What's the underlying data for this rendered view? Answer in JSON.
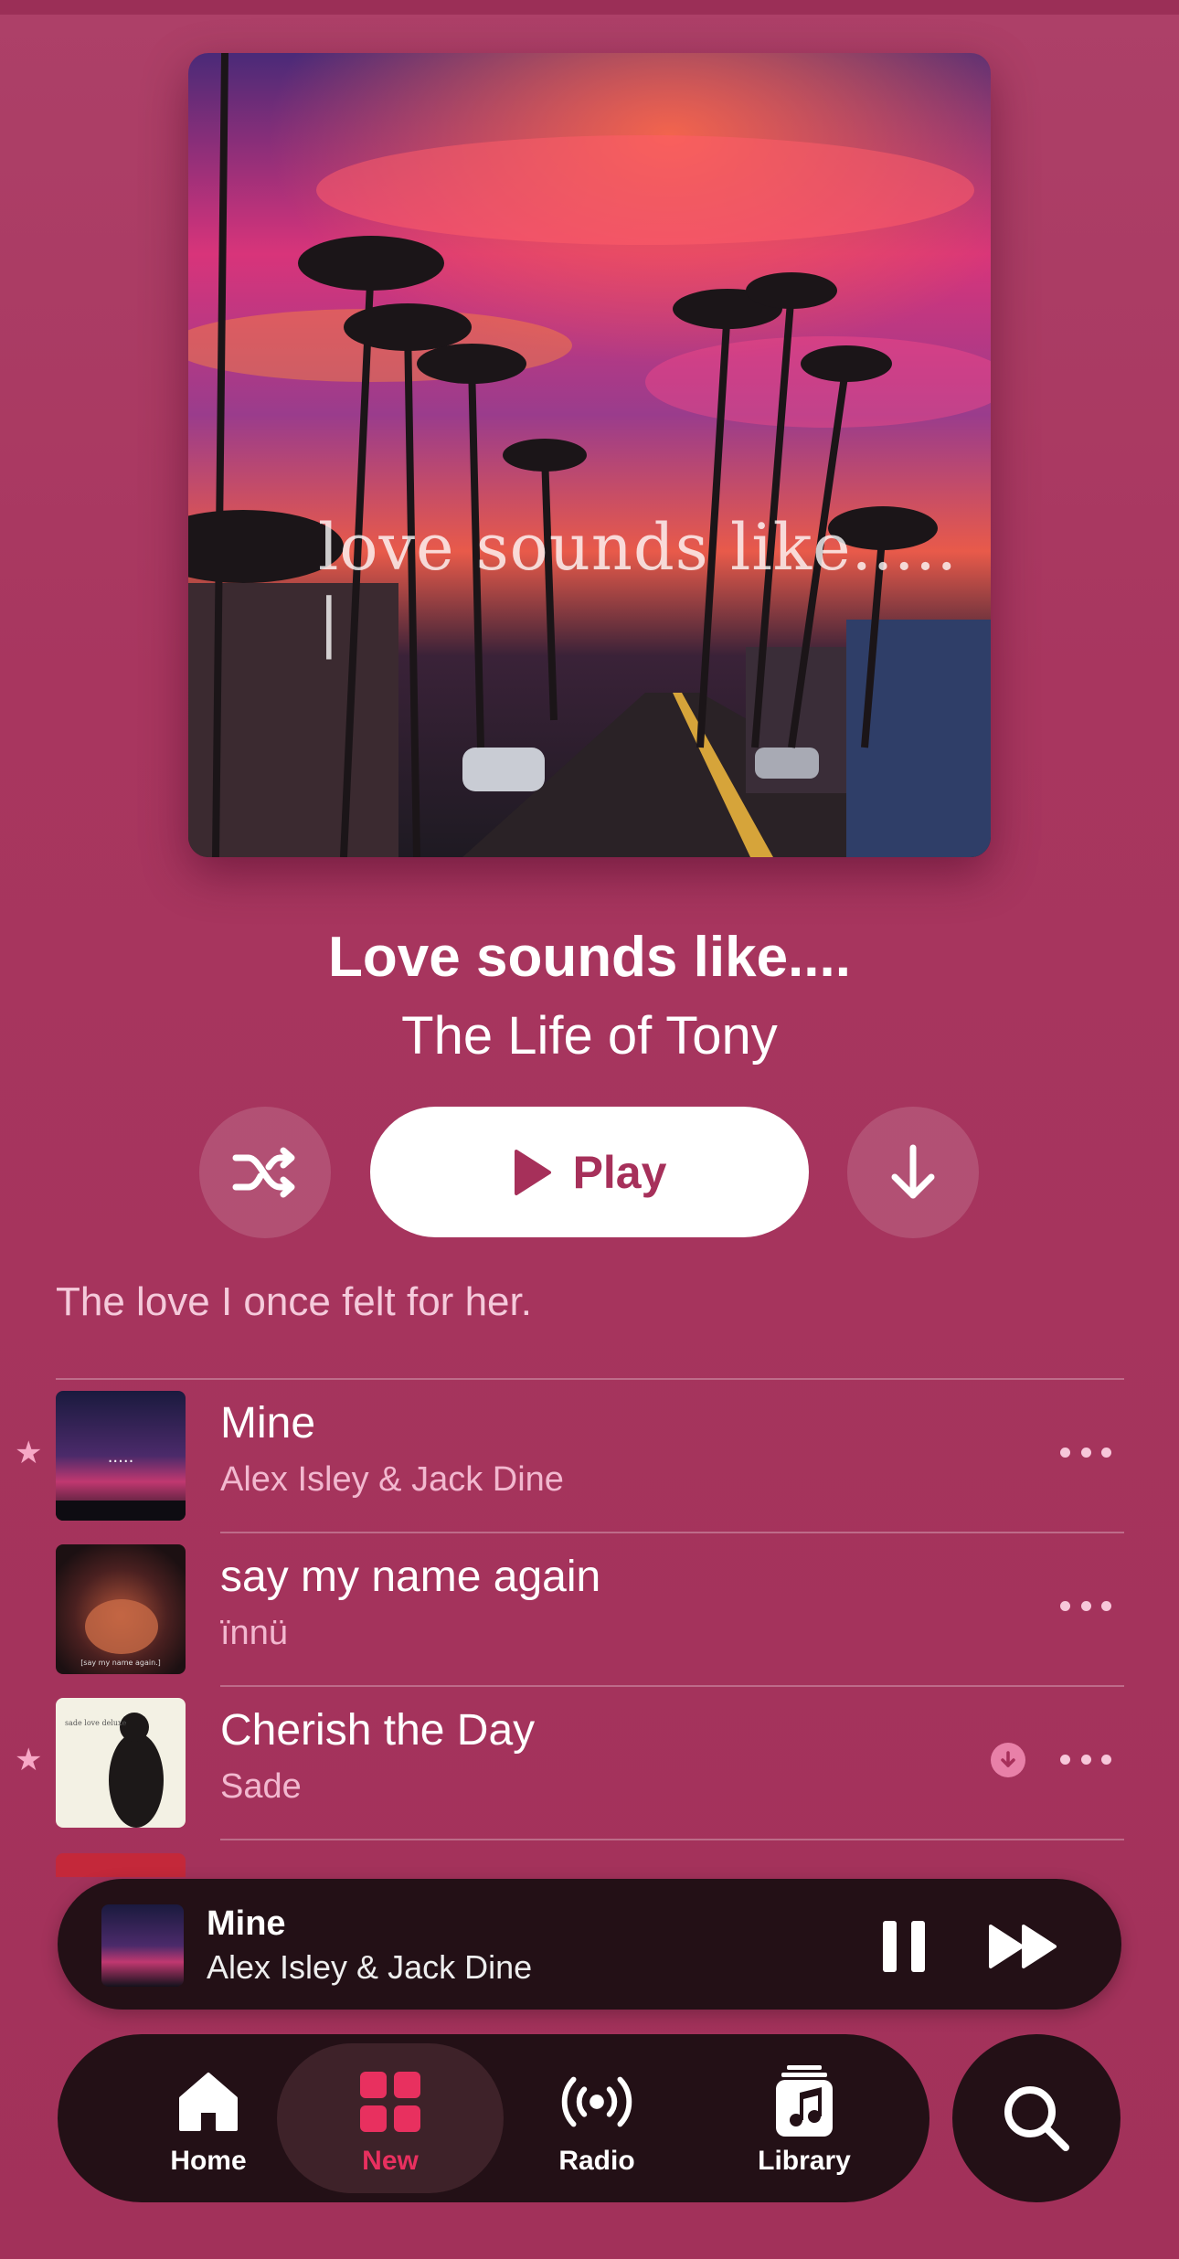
{
  "artwork": {
    "caption": "love sounds like.....",
    "caption_cursor": "|"
  },
  "playlist": {
    "title": "Love sounds like....",
    "owner": "The Life of Tony",
    "description": "The love I once felt for her."
  },
  "controls": {
    "shuffle_icon": "shuffle-icon",
    "play_label": "Play",
    "download_icon": "arrow-down-icon"
  },
  "tracks": [
    {
      "title": "Mine",
      "artist": "Alex Isley & Jack Dine",
      "favorite": true,
      "downloaded": false,
      "art_text": "....."
    },
    {
      "title": "say my name again",
      "artist": "ïnnü",
      "favorite": false,
      "downloaded": false,
      "art_text": "[say my name again.]"
    },
    {
      "title": "Cherish the Day",
      "artist": "Sade",
      "favorite": true,
      "downloaded": true,
      "art_text": "sade love deluxe"
    }
  ],
  "now_playing": {
    "title": "Mine",
    "artist": "Alex Isley & Jack Dine"
  },
  "tabs": [
    {
      "label": "Home",
      "icon": "house-icon",
      "active": false
    },
    {
      "label": "New",
      "icon": "grid-icon",
      "active": true
    },
    {
      "label": "Radio",
      "icon": "radio-waves-icon",
      "active": false
    },
    {
      "label": "Library",
      "icon": "music-note-stack-icon",
      "active": false
    }
  ],
  "colors": {
    "background": "#a63560",
    "accent": "#e8305f",
    "player_bg": "#231016"
  }
}
